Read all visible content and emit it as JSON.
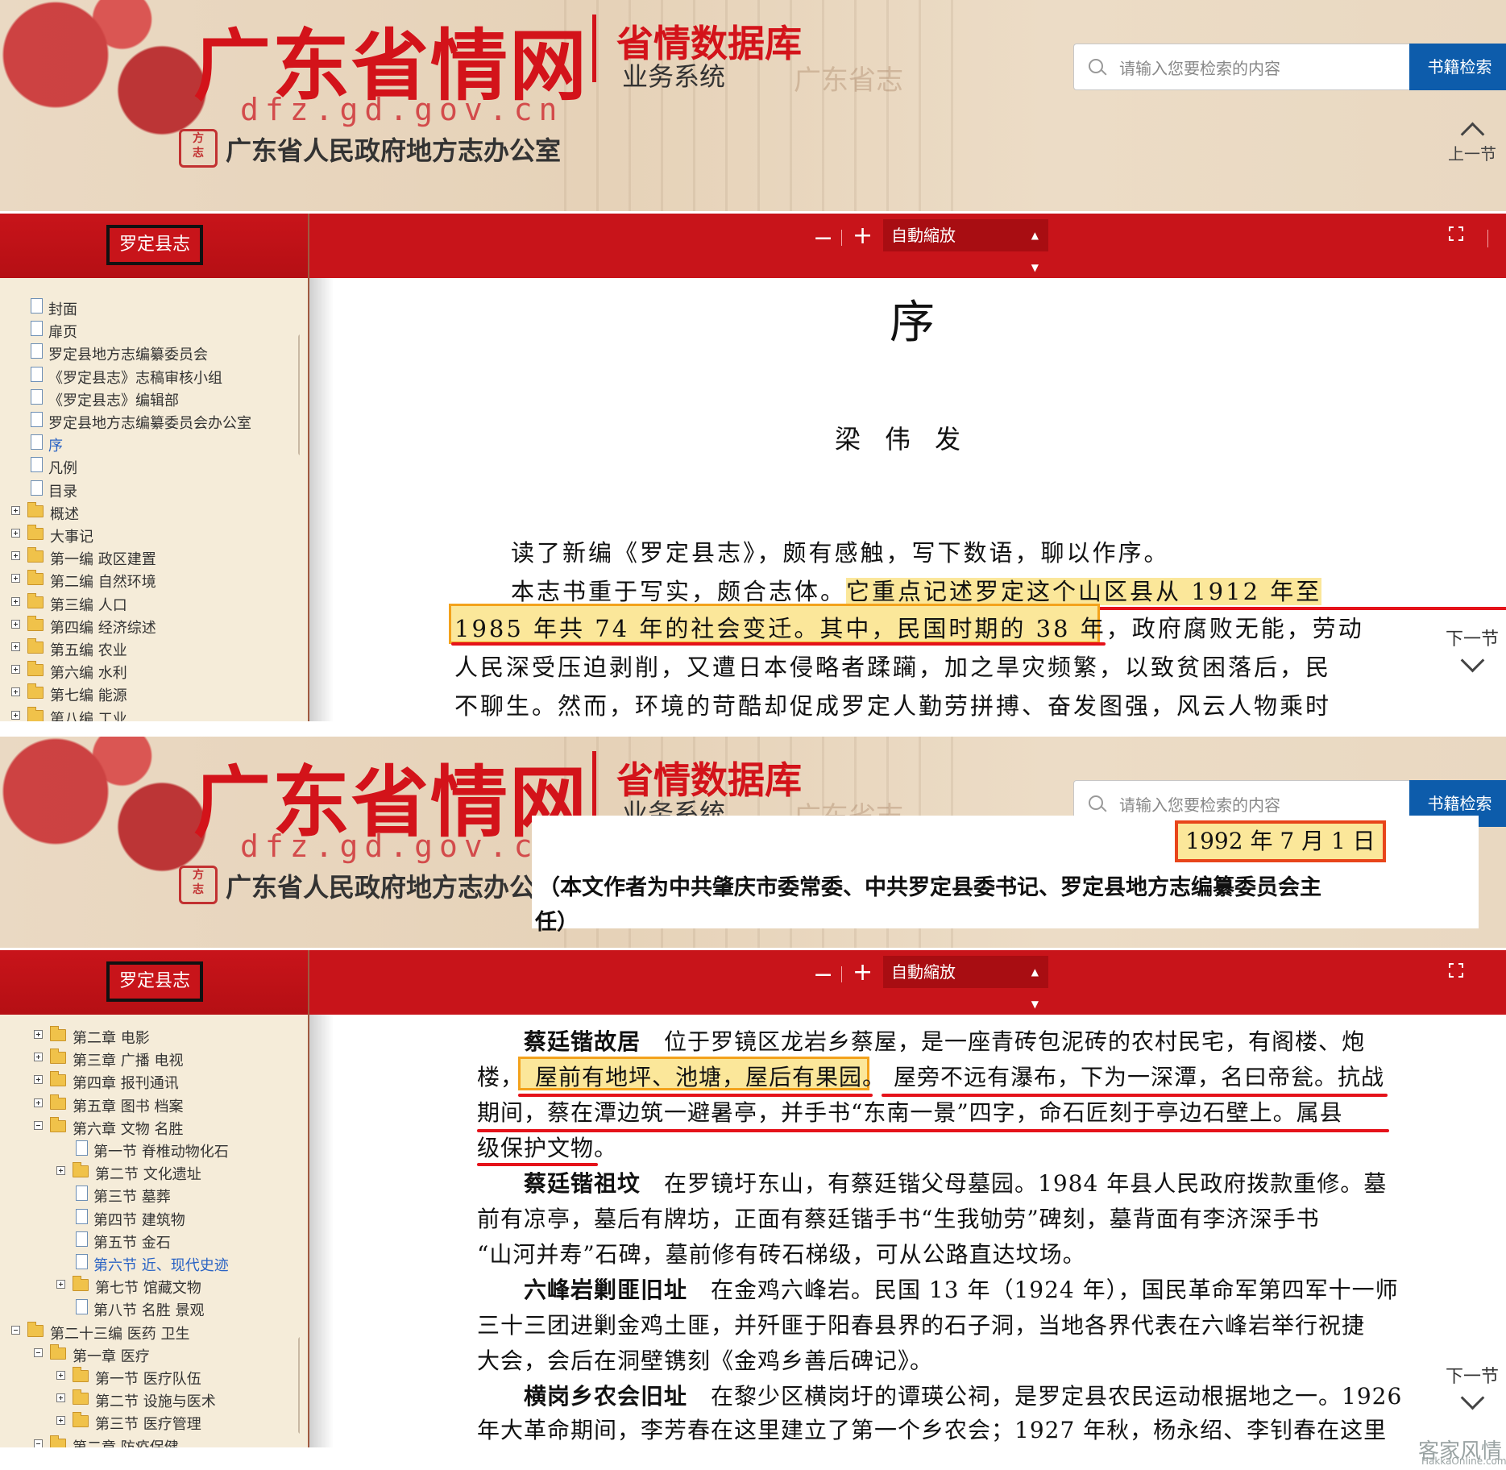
{
  "header": {
    "site_title": "广东省情网",
    "db_title": "省情数据库",
    "system_label": "业务系统",
    "faint_label": "广东省志",
    "url": "dfz.gd.gov.cn",
    "seal_text": "广东方志",
    "office": "广东省人民政府地方志办公室",
    "search_placeholder": "请输入您要检索的内容",
    "search_button": "书籍检索",
    "prev_section": "上一节"
  },
  "sidebar": {
    "book_title": "罗定县志"
  },
  "toolbar": {
    "zoom_out": "−",
    "zoom_in": "+",
    "zoom_mode": "自動縮放"
  },
  "panel1": {
    "tree": [
      {
        "label": "封面",
        "type": "page"
      },
      {
        "label": "扉页",
        "type": "page"
      },
      {
        "label": "罗定县地方志编纂委员会",
        "type": "page"
      },
      {
        "label": "《罗定县志》志稿审核小组",
        "type": "page"
      },
      {
        "label": "《罗定县志》编辑部",
        "type": "page"
      },
      {
        "label": "罗定县地方志编纂委员会办公室",
        "type": "page"
      },
      {
        "label": "序",
        "type": "page",
        "active": true
      },
      {
        "label": "凡例",
        "type": "page"
      },
      {
        "label": "目录",
        "type": "page"
      },
      {
        "label": "概述",
        "type": "folder"
      },
      {
        "label": "大事记",
        "type": "folder"
      },
      {
        "label": "第一编 政区建置",
        "type": "folder"
      },
      {
        "label": "第二编 自然环境",
        "type": "folder"
      },
      {
        "label": "第三编 人口",
        "type": "folder"
      },
      {
        "label": "第四编 经济综述",
        "type": "folder"
      },
      {
        "label": "第五编 农业",
        "type": "folder"
      },
      {
        "label": "第六编 水利",
        "type": "folder"
      },
      {
        "label": "第七编 能源",
        "type": "folder"
      },
      {
        "label": "第八编 工业",
        "type": "folder"
      }
    ],
    "doc": {
      "title": "序",
      "author": "梁伟发",
      "l1": "读了新编《罗定县志》，颇有感触，写下数语，聊以作序。",
      "l2a": "本志书重于写实，颇合志体。",
      "l2b": "它重点记述罗定这个山区县从 1912 年至",
      "l3a": "1985 年共 74 年的社会变迁",
      "l3b": "。其中，民国时期的 38 年，政府腐败无能，劳动",
      "l4": "人民深受压迫剥削，又遭日本侵略者蹂躏，加之旱灾频繁，以致贫困落后，民",
      "l5": "不聊生。然而，环境的苛酷却促成罗定人勤劳拼搏、奋发图强，风云人物乘时"
    },
    "next_section": "下一节"
  },
  "panel2": {
    "overlay": {
      "date": "1992 年 7 月 1 日",
      "note1": "（本文作者为中共肇庆市委常委、中共罗定县委书记、罗定县地方志编纂委员会主",
      "note2": "任）"
    },
    "tree": [
      {
        "label": "第二章 电影",
        "type": "folder",
        "depth": 1,
        "exp": "plus"
      },
      {
        "label": "第三章 广播 电视",
        "type": "folder",
        "depth": 1,
        "exp": "plus"
      },
      {
        "label": "第四章 报刊通讯",
        "type": "folder",
        "depth": 1,
        "exp": "plus"
      },
      {
        "label": "第五章 图书 档案",
        "type": "folder",
        "depth": 1,
        "exp": "plus"
      },
      {
        "label": "第六章 文物 名胜",
        "type": "folder",
        "depth": 1,
        "exp": "minus"
      },
      {
        "label": "第一节 脊椎动物化石",
        "type": "page",
        "depth": 2
      },
      {
        "label": "第二节 文化遗址",
        "type": "folder",
        "depth": 2,
        "exp": "plus"
      },
      {
        "label": "第三节 墓葬",
        "type": "page",
        "depth": 2
      },
      {
        "label": "第四节 建筑物",
        "type": "page",
        "depth": 2
      },
      {
        "label": "第五节 金石",
        "type": "page",
        "depth": 2
      },
      {
        "label": "第六节 近、现代史迹",
        "type": "page",
        "depth": 2,
        "active": true
      },
      {
        "label": "第七节 馆藏文物",
        "type": "folder",
        "depth": 2,
        "exp": "plus"
      },
      {
        "label": "第八节 名胜 景观",
        "type": "page",
        "depth": 2
      },
      {
        "label": "第二十三编 医药 卫生",
        "type": "folder",
        "depth": 0,
        "exp": "minus"
      },
      {
        "label": "第一章 医疗",
        "type": "folder",
        "depth": 1,
        "exp": "minus"
      },
      {
        "label": "第一节 医疗队伍",
        "type": "folder",
        "depth": 2,
        "exp": "plus"
      },
      {
        "label": "第二节 设施与医术",
        "type": "folder",
        "depth": 2,
        "exp": "plus"
      },
      {
        "label": "第三节 医疗管理",
        "type": "folder",
        "depth": 2,
        "exp": "plus"
      },
      {
        "label": "第二章 防疫保健",
        "type": "folder",
        "depth": 1,
        "exp": "minus"
      }
    ],
    "doc": {
      "h1": "蔡廷锴故居",
      "p1a": "位于罗镜区龙岩乡蔡屋，是一座青砖包泥砖的农村民宅，有阁楼、炮",
      "p1b": "楼，",
      "p1c": "屋前有地坪、池塘，屋后有果园。",
      "p1d": "屋旁不远有瀑布，下为一深潭，名曰帝瓮。抗战",
      "p1e": "期间，蔡在潭边筑一避暑亭，并手书“东南一景”四字，命石匠刻于亭边石壁上。属县",
      "p1f": "级保护文物",
      "p1g": "。",
      "h2": "蔡廷锴祖坟",
      "p2a": "在罗镜圩东山，有蔡廷锴父母墓园。1984 年县人民政府拨款重修。墓",
      "p2b": "前有凉亭，墓后有牌坊，正面有蔡廷锴手书“生我劬劳”碑刻，墓背面有李济深手书",
      "p2c": "“山河并寿”石碑，墓前修有砖石梯级，可从公路直达坟场。",
      "h3": "六峰岩剿匪旧址",
      "p3a": "在金鸡六峰岩。民国 13 年（1924 年），国民革命军第四军十一师",
      "p3b": "三十三团进剿金鸡土匪，并歼匪于阳春县界的石子洞，当地各界代表在六峰岩举行祝捷",
      "p3c": "大会，会后在洞壁镌刻《金鸡乡善后碑记》。",
      "h4": "横岗乡农会旧址",
      "p4a": "在黎少区横岗圩的谭瑛公祠，是罗定县农民运动根据地之一。1926",
      "p4b": "年大革命期间，李芳春在这里建立了第一个乡农会；1927 年秋，杨永绍、李钊春在这里"
    },
    "next_section": "下一节"
  },
  "watermark": {
    "main": "客家风情",
    "sub": "HakkaOnline.com"
  },
  "colors": {
    "brand_red": "#c8141a",
    "search_blue": "#0d5cab",
    "highlight": "#fbe79a",
    "underline_red": "#e5121a",
    "box_orange": "#f3a21c"
  }
}
